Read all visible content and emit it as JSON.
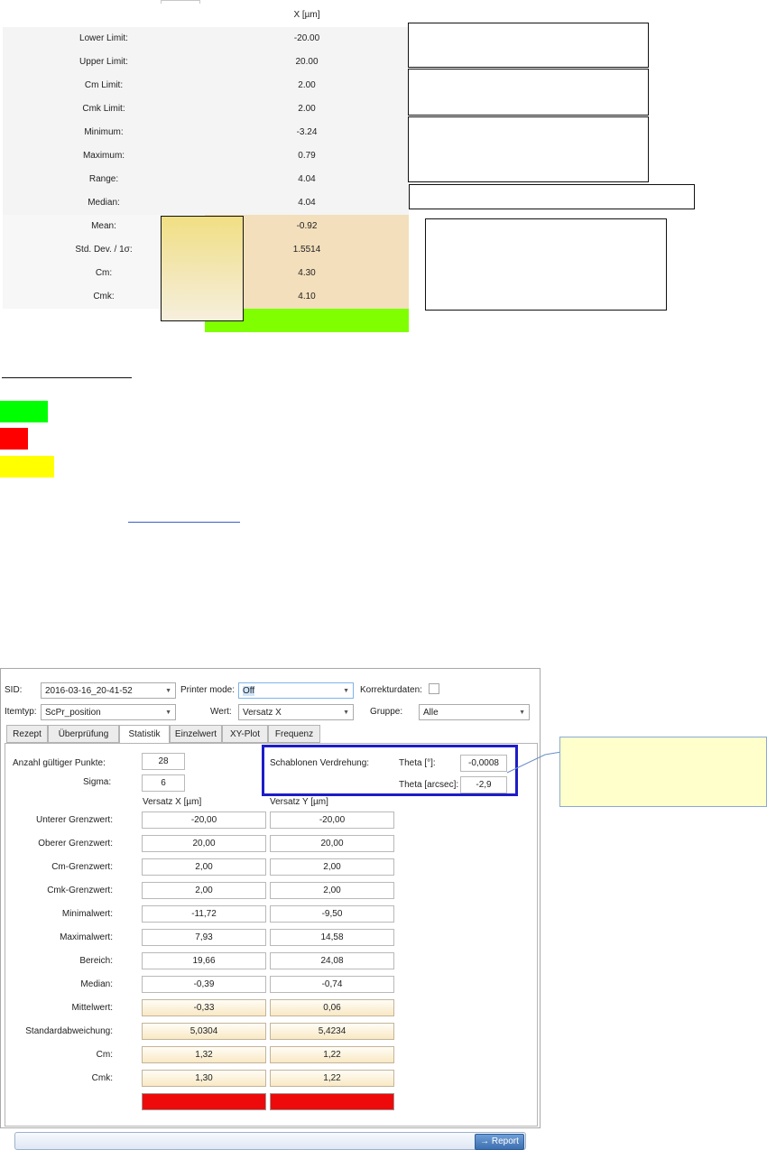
{
  "top_table": {
    "header": "X [µm]",
    "rows": [
      {
        "label": "Lower Limit:",
        "value": "-20.00"
      },
      {
        "label": "Upper Limit:",
        "value": "20.00"
      },
      {
        "label": "Cm Limit:",
        "value": "2.00"
      },
      {
        "label": "Cmk Limit:",
        "value": "2.00"
      },
      {
        "label": "Minimum:",
        "value": "-3.24"
      },
      {
        "label": "Maximum:",
        "value": "0.79"
      },
      {
        "label": "Range:",
        "value": "4.04"
      },
      {
        "label": "Median:",
        "value": "4.04"
      },
      {
        "label": "Mean:",
        "value": "-0.92"
      },
      {
        "label": "Std. Dev. / 1σ:",
        "value": "1.5514"
      },
      {
        "label": "Cm:",
        "value": "4.30"
      },
      {
        "label": "Cmk:",
        "value": "4.10"
      }
    ],
    "status_color": "#7fff00"
  },
  "legend": {
    "colors": [
      "#00ff00",
      "#ff0000",
      "#ffff00"
    ],
    "link_color": "#3a60c8"
  },
  "panel": {
    "sid_label": "SID:",
    "sid_value": "2016-03-16_20-41-52",
    "printer_mode_label": "Printer mode:",
    "printer_mode_value": "Off",
    "korrekturdaten_label": "Korrekturdaten:",
    "itemtyp_label": "Itemtyp:",
    "itemtyp_value": "ScPr_position",
    "wert_label": "Wert:",
    "wert_value": "Versatz X",
    "gruppe_label": "Gruppe:",
    "gruppe_value": "Alle",
    "tabs": [
      "Rezept",
      "Überprüfung",
      "Statistik",
      "Einzelwert",
      "XY-Plot",
      "Frequenz"
    ],
    "active_tab": "Statistik",
    "anzahl_label": "Anzahl gültiger Punkte:",
    "anzahl_value": "28",
    "sigma_label": "Sigma:",
    "sigma_value": "6",
    "schablonen_label": "Schablonen Verdrehung:",
    "theta_deg_label": "Theta [°]:",
    "theta_deg_value": "-0,0008",
    "theta_arcsec_label": "Theta [arcsec]:",
    "theta_arcsec_value": "-2,9",
    "col_x_header": "Versatz X [µm]",
    "col_y_header": "Versatz Y [µm]",
    "stats": [
      {
        "label": "Unterer Grenzwert:",
        "x": "-20,00",
        "y": "-20,00"
      },
      {
        "label": "Oberer Grenzwert:",
        "x": "20,00",
        "y": "20,00"
      },
      {
        "label": "Cm-Grenzwert:",
        "x": "2,00",
        "y": "2,00"
      },
      {
        "label": "Cmk-Grenzwert:",
        "x": "2,00",
        "y": "2,00"
      },
      {
        "label": "Minimalwert:",
        "x": "-11,72",
        "y": "-9,50"
      },
      {
        "label": "Maximalwert:",
        "x": "7,93",
        "y": "14,58"
      },
      {
        "label": "Bereich:",
        "x": "19,66",
        "y": "24,08"
      },
      {
        "label": "Median:",
        "x": "-0,39",
        "y": "-0,74"
      },
      {
        "label": "Mittelwert:",
        "x": "-0,33",
        "y": "0,06"
      },
      {
        "label": "Standardabweichung:",
        "x": "5,0304",
        "y": "5,4234"
      },
      {
        "label": "Cm:",
        "x": "1,32",
        "y": "1,22"
      },
      {
        "label": "Cmk:",
        "x": "1,30",
        "y": "1,22"
      }
    ],
    "status_color": "#ee0a0a",
    "report_button": "→ Report"
  }
}
